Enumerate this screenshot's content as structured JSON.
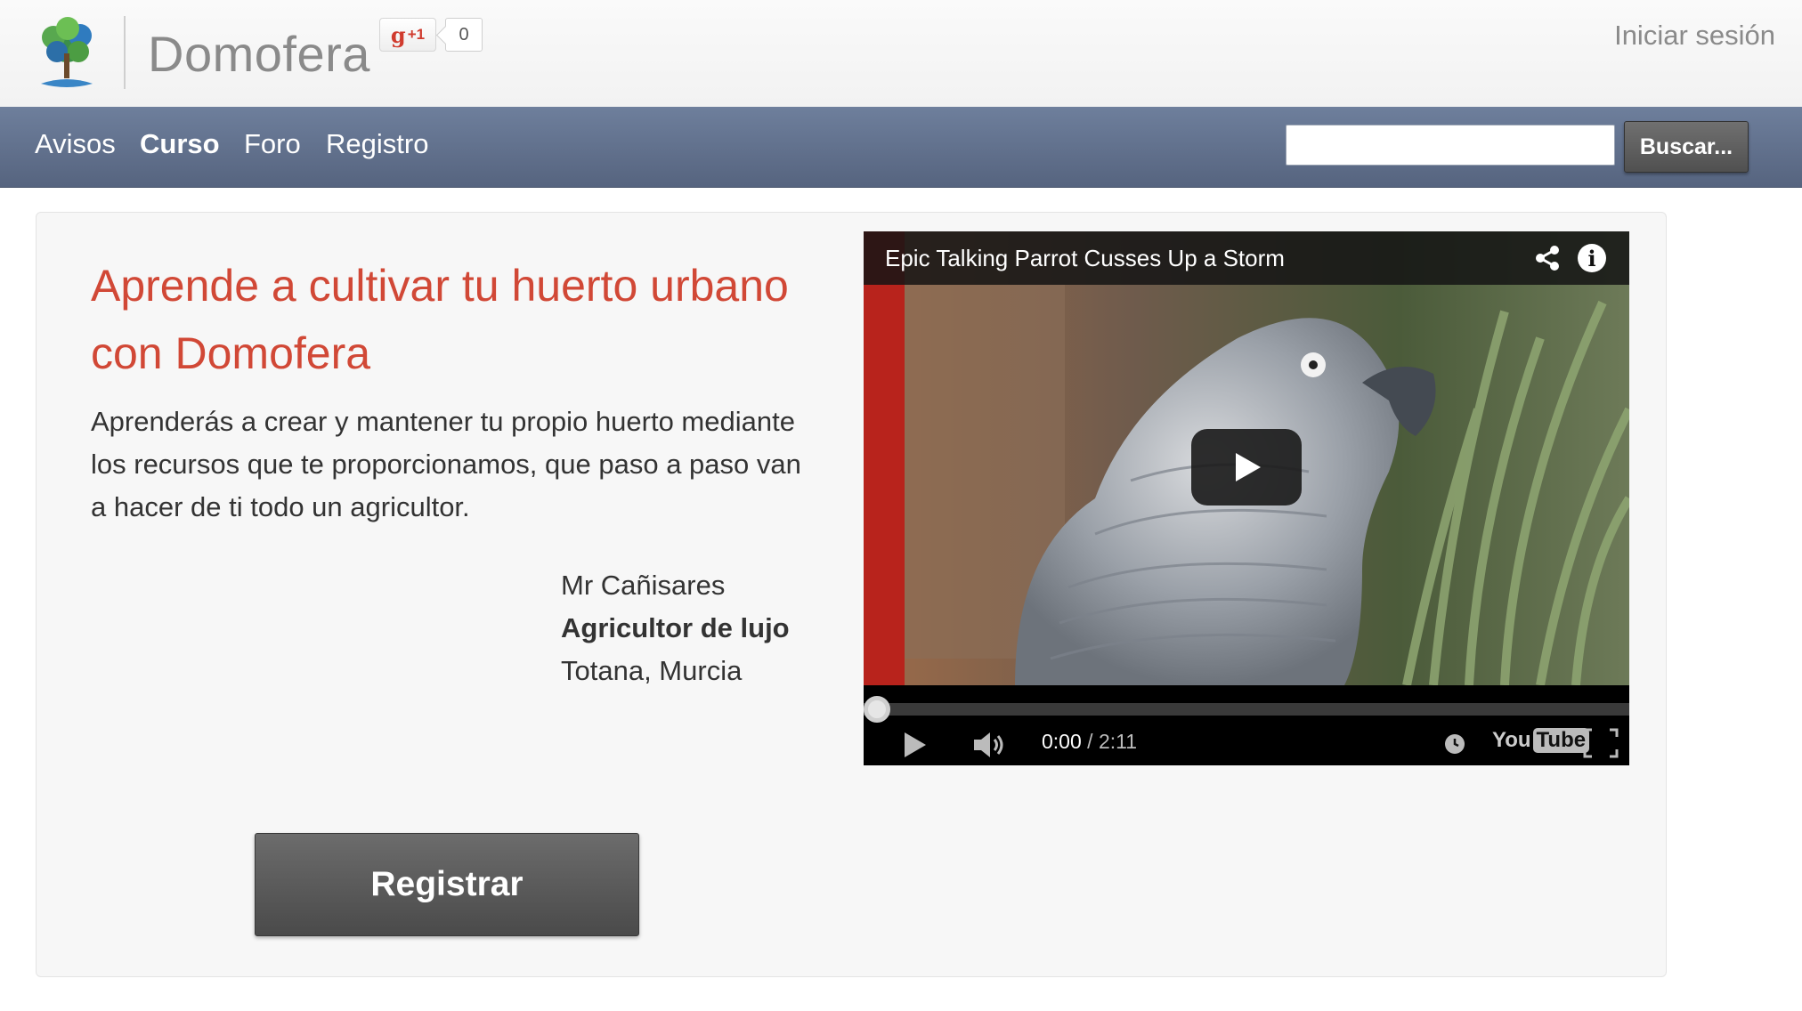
{
  "header": {
    "brand": "Domofera",
    "gplus_label": "g",
    "gplus_plus": "+1",
    "gplus_count": "0",
    "login": "Iniciar sesión"
  },
  "nav": {
    "items": [
      {
        "label": "Avisos",
        "active": false
      },
      {
        "label": "Curso",
        "active": true
      },
      {
        "label": "Foro",
        "active": false
      },
      {
        "label": "Registro",
        "active": false
      }
    ],
    "search_value": "",
    "search_button": "Buscar..."
  },
  "hero": {
    "headline": "Aprende a cultivar tu huerto urbano con Domofera",
    "lead": "Aprenderás a crear y mantener tu propio huerto mediante los recursos que te proporcionamos, que paso a paso van a hacer de ti todo un agricultor.",
    "testimonial": {
      "name": "Mr Cañisares",
      "role": "Agricultor de lujo",
      "location": "Totana, Murcia"
    },
    "register_button": "Registrar"
  },
  "video": {
    "title": "Epic Talking Parrot Cusses Up a Storm",
    "current_time": "0:00",
    "separator": " / ",
    "duration": "2:11",
    "progress": 0,
    "yt_you": "You",
    "yt_tube": "Tube"
  },
  "colors": {
    "accent": "#d14836",
    "navbar": "#5f6f8c"
  }
}
